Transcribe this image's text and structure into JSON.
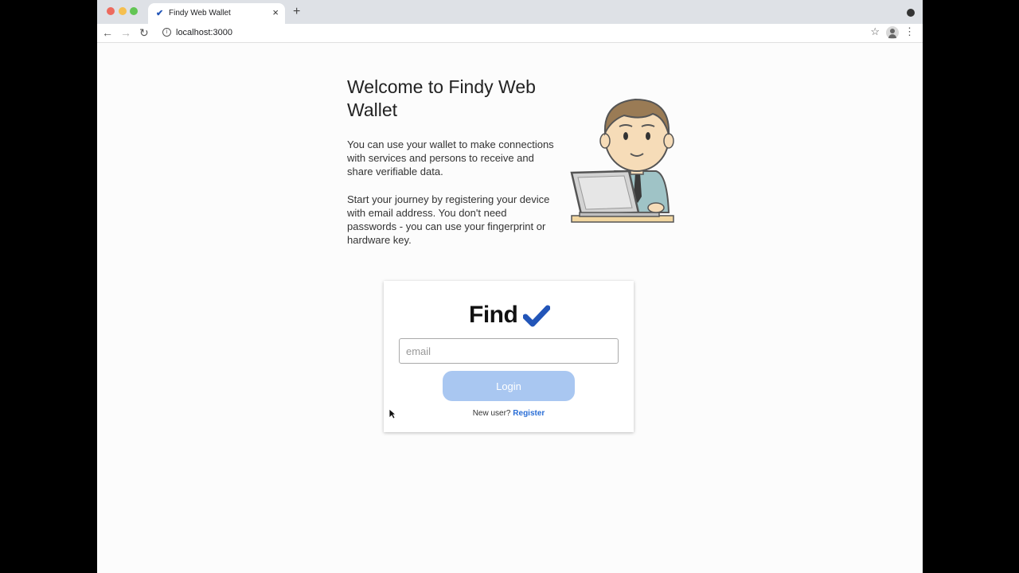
{
  "browser": {
    "tab_title": "Findy Web Wallet",
    "tab_close": "×",
    "new_tab": "+",
    "back": "←",
    "forward": "→",
    "reload": "↻",
    "info": "i",
    "url": "localhost:3000",
    "bookmark": "☆",
    "menu": "⋮"
  },
  "intro": {
    "title": "Welcome to Findy Web Wallet",
    "paragraph1": "You can use your wallet to make connections with services and persons to receive and share verifiable data.",
    "paragraph2": "Start your journey by registering your device with email address. You don't need passwords - you can use your fingerprint or hardware key."
  },
  "login_card": {
    "logo_text": "Find",
    "email_placeholder": "email",
    "email_value": "",
    "login_label": "Login",
    "new_user_text": "New user?",
    "register_label": "Register"
  },
  "colors": {
    "accent": "#2a6ed6",
    "login_button_disabled": "#a9c7f1",
    "logo_check": "#2255b8"
  },
  "icons": {
    "favicon": "findy-check-icon",
    "illustration": "man-with-laptop-illustration"
  }
}
